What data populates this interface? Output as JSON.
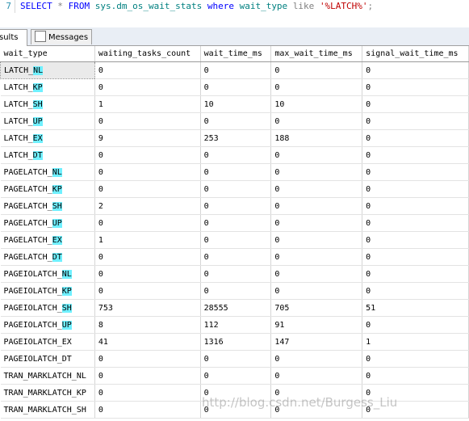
{
  "editor": {
    "line_number": "7",
    "tokens": {
      "select": "SELECT",
      "star": "*",
      "from": "FROM",
      "object": "sys.dm_os_wait_stats",
      "where": "where",
      "column": "wait_type",
      "like": "like",
      "literal": "'%LATCH%'",
      "semicolon": ";"
    }
  },
  "tabs": {
    "results_label": "sults",
    "messages_label": "Messages"
  },
  "grid": {
    "columns": [
      "wait_type",
      "waiting_tasks_count",
      "wait_time_ms",
      "max_wait_time_ms",
      "signal_wait_time_ms"
    ],
    "rows": [
      [
        "LATCH_NL",
        "0",
        "0",
        "0",
        "0"
      ],
      [
        "LATCH_KP",
        "0",
        "0",
        "0",
        "0"
      ],
      [
        "LATCH_SH",
        "1",
        "10",
        "10",
        "0"
      ],
      [
        "LATCH_UP",
        "0",
        "0",
        "0",
        "0"
      ],
      [
        "LATCH_EX",
        "9",
        "253",
        "188",
        "0"
      ],
      [
        "LATCH_DT",
        "0",
        "0",
        "0",
        "0"
      ],
      [
        "PAGELATCH_NL",
        "0",
        "0",
        "0",
        "0"
      ],
      [
        "PAGELATCH_KP",
        "0",
        "0",
        "0",
        "0"
      ],
      [
        "PAGELATCH_SH",
        "2",
        "0",
        "0",
        "0"
      ],
      [
        "PAGELATCH_UP",
        "0",
        "0",
        "0",
        "0"
      ],
      [
        "PAGELATCH_EX",
        "1",
        "0",
        "0",
        "0"
      ],
      [
        "PAGELATCH_DT",
        "0",
        "0",
        "0",
        "0"
      ],
      [
        "PAGEIOLATCH_NL",
        "0",
        "0",
        "0",
        "0"
      ],
      [
        "PAGEIOLATCH_KP",
        "0",
        "0",
        "0",
        "0"
      ],
      [
        "PAGEIOLATCH_SH",
        "753",
        "28555",
        "705",
        "51"
      ],
      [
        "PAGEIOLATCH_UP",
        "8",
        "112",
        "91",
        "0"
      ],
      [
        "PAGEIOLATCH_EX",
        "41",
        "1316",
        "147",
        "1"
      ],
      [
        "PAGEIOLATCH_DT",
        "0",
        "0",
        "0",
        "0"
      ],
      [
        "TRAN_MARKLATCH_NL",
        "0",
        "0",
        "0",
        "0"
      ],
      [
        "TRAN_MARKLATCH_KP",
        "0",
        "0",
        "0",
        "0"
      ],
      [
        "TRAN_MARKLATCH_SH",
        "0",
        "0",
        "0",
        "0"
      ]
    ]
  },
  "watermark": "http://blog.csdn.net/Burgess_Liu",
  "colors": {
    "highlight": "#6ff0ff",
    "keyword": "#0000ff",
    "string": "#c00000"
  }
}
